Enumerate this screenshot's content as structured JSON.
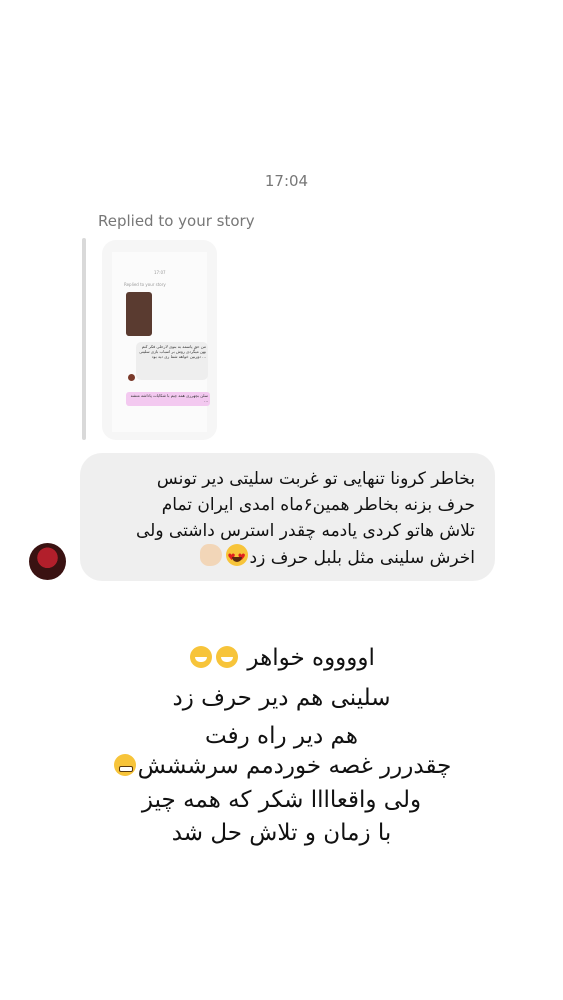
{
  "chat": {
    "timestamp": "17:04",
    "replied_label": "Replied to your story",
    "story_preview": {
      "time": "17:07",
      "replied_label": "Replied to your story",
      "bubble_text": "من حق پاسمه به بنوی لارحلی فکر کنم بهن میگردی روش بر اسباب بازی سلیتی ... دوربین خواهه شما ری دید بود",
      "pink_text": "سلن بچهرری همه چیم با شکایات پاداشه متشه ..."
    },
    "message": {
      "lines": [
        "بخاطر کرونا تنهایی تو  غربت سلیتی دیر تونس",
        "حرف بزنه بخاطر همین۶ماه امدی ایران تمام",
        "تلاش هاتو کردی یادمه چقدر استرس داشتی ولی",
        "اخرش سلینی مثل بلبل  حرف زد"
      ],
      "emojis": [
        "heart-eyes-emoji",
        "ok-hand-emoji"
      ]
    }
  },
  "caption": {
    "lines": [
      "اووووه خواهر",
      "سلینی هم دیر حرف زد",
      "هم دیر راه رفت",
      "چقدررر غصه خوردمم سرششش",
      "ولی واقعاااا شکر که همه چیز",
      "با زمان و تلاش حل شد"
    ]
  }
}
